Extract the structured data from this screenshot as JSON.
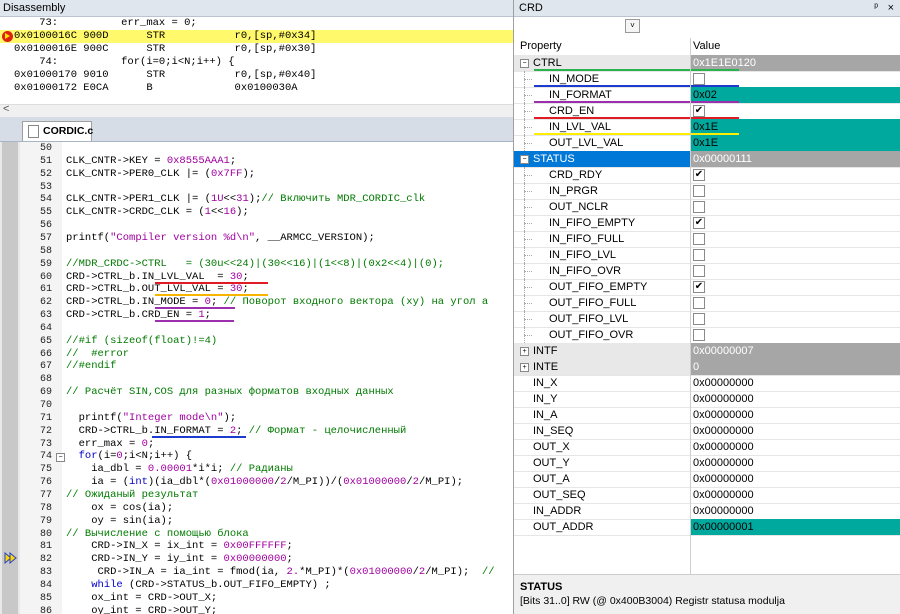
{
  "disassembly": {
    "title": "Disassembly",
    "lines": [
      {
        "text": "    73:          err_max = 0;",
        "hl": false,
        "cur": false
      },
      {
        "text": "0x0100016C 900D      STR           r0,[sp,#0x34]",
        "hl": true,
        "cur": true
      },
      {
        "text": "0x0100016E 900C      STR           r0,[sp,#0x30]",
        "hl": false,
        "cur": false
      },
      {
        "text": "    74:          for(i=0;i<N;i++) {",
        "hl": false,
        "cur": false
      },
      {
        "text": "0x01000170 9010      STR           r0,[sp,#0x40]",
        "hl": false,
        "cur": false
      },
      {
        "text": "0x01000172 E0CA      B             0x0100030A",
        "hl": false,
        "cur": false
      }
    ],
    "scroll_left": "<"
  },
  "editor": {
    "tab_label": "CORDIC.c",
    "lines": [
      {
        "n": "50",
        "html": ""
      },
      {
        "n": "51",
        "html": "CLK_CNTR->KEY = <span class='c-num'>0x8555AAA1</span>;"
      },
      {
        "n": "52",
        "html": "CLK_CNTR->PER0_CLK |= (<span class='c-num'>0x7FF</span>);"
      },
      {
        "n": "53",
        "html": ""
      },
      {
        "n": "54",
        "html": "CLK_CNTR->PER1_CLK |= (<span class='c-num'>1U</span>&lt;&lt;<span class='c-num'>31</span>);<span class='c-cm'>// Включить MDR_CORDIC_clk</span>"
      },
      {
        "n": "55",
        "html": "CLK_CNTR->CRDC_CLK = (<span class='c-num'>1</span>&lt;&lt;<span class='c-num'>16</span>);"
      },
      {
        "n": "56",
        "html": ""
      },
      {
        "n": "57",
        "html": "printf(<span class='c-str'>\"Compiler version %d\\n\"</span>, __ARMCC_VERSION);"
      },
      {
        "n": "58",
        "html": ""
      },
      {
        "n": "59",
        "html": "<span class='c-cm'>//MDR_CRDC->CTRL   = (30u&lt;&lt;24)|(30&lt;&lt;16)|(1&lt;&lt;8)|(0x2&lt;&lt;4)|(0);</span>"
      },
      {
        "n": "60",
        "html": "CRD->CTRL_b.IN_LVL_VAL  = <span class='c-num'>30</span>;"
      },
      {
        "n": "61",
        "html": "CRD->CTRL_b.OUT_LVL_VAL = <span class='c-num'>30</span>;"
      },
      {
        "n": "62",
        "html": "CRD->CTRL_b.IN_MODE = <span class='c-num'>0</span>; <span class='c-cm'>// Поворот входного вектора (xy) на угол а</span>"
      },
      {
        "n": "63",
        "html": "CRD->CTRL_b.CRD_EN = <span class='c-num'>1</span>;"
      },
      {
        "n": "64",
        "html": ""
      },
      {
        "n": "65",
        "html": "<span class='c-cm'>//#if (sizeof(float)!=4)</span>"
      },
      {
        "n": "66",
        "html": "<span class='c-cm'>//  #error</span>"
      },
      {
        "n": "67",
        "html": "<span class='c-cm'>//#endif</span>"
      },
      {
        "n": "68",
        "html": ""
      },
      {
        "n": "69",
        "html": "<span class='c-cm'>// Расчёт SIN,COS для разных форматов входных данных</span>"
      },
      {
        "n": "70",
        "html": ""
      },
      {
        "n": "71",
        "html": "  printf(<span class='c-str'>\"Integer mode\\n\"</span>);"
      },
      {
        "n": "72",
        "html": "  CRD->CTRL_b.IN_FORMAT = <span class='c-num'>2</span>; <span class='c-cm'>// Формат - целочисленный</span>"
      },
      {
        "n": "73",
        "html": "  err_max = <span class='c-num'>0</span>;"
      },
      {
        "n": "74",
        "html": "  <span class='c-kw'>for</span>(i=<span class='c-num'>0</span>;i&lt;N;i++) {"
      },
      {
        "n": "75",
        "html": "    ia_dbl = <span class='c-num'>0.00001</span>*i*i; <span class='c-cm'>// Радианы</span>"
      },
      {
        "n": "76",
        "html": "    ia = (<span class='c-kw'>int</span>)(ia_dbl*(<span class='c-num'>0x01000000</span>/<span class='c-num'>2</span>/M_PI))/(<span class='c-num'>0x01000000</span>/<span class='c-num'>2</span>/M_PI);"
      },
      {
        "n": "77",
        "html": "<span class='c-cm'>// Ожиданый результат</span>"
      },
      {
        "n": "78",
        "html": "    ox = cos(ia);"
      },
      {
        "n": "79",
        "html": "    oy = sin(ia);"
      },
      {
        "n": "80",
        "html": "<span class='c-cm'>// Вычисление с помощью блока</span>"
      },
      {
        "n": "81",
        "html": "    CRD->IN_X = ix_int = <span class='c-num'>0x00FFFFFF</span>;"
      },
      {
        "n": "82",
        "html": "    CRD->IN_Y = iy_int = <span class='c-num'>0x00000000</span>;"
      },
      {
        "n": "83",
        "html": "     CRD->IN_A = ia_int = fmod(ia, <span class='c-num'>2.</span>*M_PI)*(<span class='c-num'>0x01000000</span>/<span class='c-num'>2</span>/M_PI);  <span class='c-cm'>//</span>"
      },
      {
        "n": "84",
        "html": "    <span class='c-kw'>while</span> (CRD->STATUS_b.OUT_FIFO_EMPTY) ;"
      },
      {
        "n": "85",
        "html": "    ox_int = CRD->OUT_X;"
      },
      {
        "n": "86",
        "html": "    oy_int = CRD->OUT_Y;"
      }
    ]
  },
  "crd": {
    "title": "CRD",
    "pin": "ᵖ",
    "close": "×",
    "dropdown": "˅",
    "header_property": "Property",
    "header_value": "Value",
    "rows": [
      {
        "name": "CTRL",
        "value": "0x1E1E0120",
        "kind": "group",
        "expand": "−"
      },
      {
        "name": "IN_MODE",
        "value": "",
        "kind": "check",
        "checked": ""
      },
      {
        "name": "IN_FORMAT",
        "value": "0x02",
        "kind": "field",
        "teal": true
      },
      {
        "name": "CRD_EN",
        "value": "",
        "kind": "check",
        "checked": "✔"
      },
      {
        "name": "IN_LVL_VAL",
        "value": "0x1E",
        "kind": "field",
        "teal": true
      },
      {
        "name": "OUT_LVL_VAL",
        "value": "0x1E",
        "kind": "field",
        "teal": true
      },
      {
        "name": "STATUS",
        "value": "0x00000111",
        "kind": "group-sel",
        "expand": "−"
      },
      {
        "name": "CRD_RDY",
        "value": "",
        "kind": "check",
        "checked": "✔"
      },
      {
        "name": "IN_PRGR",
        "value": "",
        "kind": "check",
        "checked": ""
      },
      {
        "name": "OUT_NCLR",
        "value": "",
        "kind": "check",
        "checked": ""
      },
      {
        "name": "IN_FIFO_EMPTY",
        "value": "",
        "kind": "check",
        "checked": "✔"
      },
      {
        "name": "IN_FIFO_FULL",
        "value": "",
        "kind": "check",
        "checked": ""
      },
      {
        "name": "IN_FIFO_LVL",
        "value": "",
        "kind": "check",
        "checked": ""
      },
      {
        "name": "IN_FIFO_OVR",
        "value": "",
        "kind": "check",
        "checked": ""
      },
      {
        "name": "OUT_FIFO_EMPTY",
        "value": "",
        "kind": "check",
        "checked": "✔"
      },
      {
        "name": "OUT_FIFO_FULL",
        "value": "",
        "kind": "check",
        "checked": ""
      },
      {
        "name": "OUT_FIFO_LVL",
        "value": "",
        "kind": "check",
        "checked": ""
      },
      {
        "name": "OUT_FIFO_OVR",
        "value": "",
        "kind": "check",
        "checked": ""
      },
      {
        "name": "INTF",
        "value": "0x00000007",
        "kind": "group",
        "expand": "+"
      },
      {
        "name": "INTE",
        "value": "0",
        "kind": "group",
        "expand": "+"
      },
      {
        "name": "IN_X",
        "value": "0x00000000",
        "kind": "top"
      },
      {
        "name": "IN_Y",
        "value": "0x00000000",
        "kind": "top"
      },
      {
        "name": "IN_A",
        "value": "0x00000000",
        "kind": "top"
      },
      {
        "name": "IN_SEQ",
        "value": "0x00000000",
        "kind": "top"
      },
      {
        "name": "OUT_X",
        "value": "0x00000000",
        "kind": "top"
      },
      {
        "name": "OUT_Y",
        "value": "0x00000000",
        "kind": "top"
      },
      {
        "name": "OUT_A",
        "value": "0x00000000",
        "kind": "top"
      },
      {
        "name": "OUT_SEQ",
        "value": "0x00000000",
        "kind": "top"
      },
      {
        "name": "IN_ADDR",
        "value": "0x00000000",
        "kind": "top"
      },
      {
        "name": "OUT_ADDR",
        "value": "0x00000001",
        "kind": "top",
        "teal": true
      }
    ],
    "status_title": "STATUS",
    "status_desc": "[Bits 31..0] RW (@ 0x400B3004) Registr statusa modulja"
  },
  "colors": {
    "teal": "#00a99d",
    "selected": "#0078d7",
    "group_bg": "#a6a6a6",
    "highlight": "#fff96b",
    "ul_red": "#e01b24",
    "ul_orange": "#f7b500",
    "ul_purple": "#9b2fae",
    "ul_blue": "#1d3ccf",
    "ul_green": "#2ab24c",
    "ul_yellow": "#ffee00"
  }
}
